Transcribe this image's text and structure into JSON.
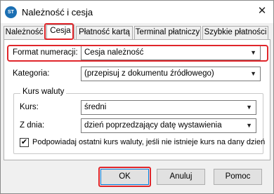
{
  "window": {
    "title": "Należność i cesja",
    "icon_label": "ST",
    "close_symbol": "✕"
  },
  "tabs": [
    {
      "label": "Należność",
      "active": false
    },
    {
      "label": "Cesja",
      "active": true
    },
    {
      "label": "Płatność kartą",
      "active": false
    },
    {
      "label": "Terminal płatniczy",
      "active": false
    },
    {
      "label": "Szybkie płatności",
      "active": false
    }
  ],
  "form": {
    "format_label": "Format numeracji:",
    "format_value": "Cesja należność",
    "category_label": "Kategoria:",
    "category_value": "(przepisuj z dokumentu źródłowego)",
    "currency_group_title": "Kurs waluty",
    "rate_label": "Kurs:",
    "rate_value": "średni",
    "day_label": "Z dnia:",
    "day_value": "dzień poprzedzający datę wystawienia",
    "suggest_checkbox_label": "Podpowiadaj ostatni kurs waluty, jeśli nie istnieje kurs na dany dzień",
    "suggest_checked": true,
    "dropdown_arrow": "▼",
    "check_mark": "✔"
  },
  "buttons": {
    "ok": "OK",
    "cancel": "Anuluj",
    "help": "Pomoc"
  },
  "highlight_color": "#e0262b",
  "accent_color": "#0078d7"
}
